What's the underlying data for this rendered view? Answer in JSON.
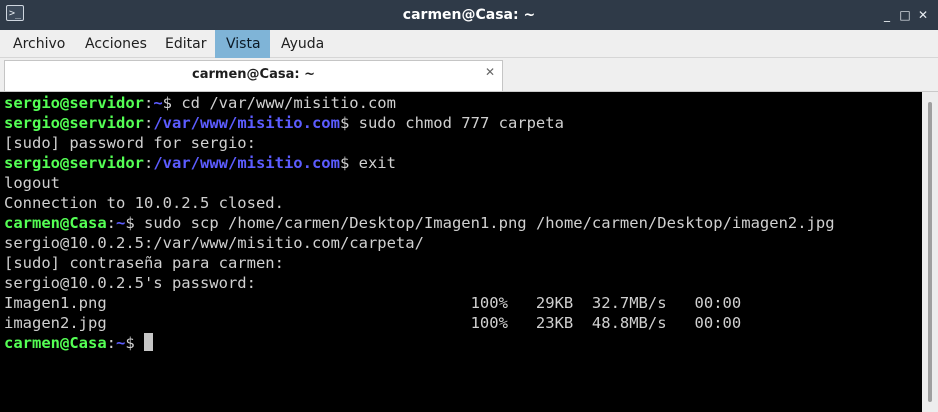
{
  "window": {
    "title": "carmen@Casa: ~",
    "icon": "terminal-icon",
    "controls": {
      "minimize": "_",
      "maximize": "□",
      "close": "✕"
    }
  },
  "menu": {
    "items": [
      {
        "label": "Archivo",
        "active": false
      },
      {
        "label": "Acciones",
        "active": false
      },
      {
        "label": "Editar",
        "active": false
      },
      {
        "label": "Vista",
        "active": true
      },
      {
        "label": "Ayuda",
        "active": false
      }
    ]
  },
  "tabs": [
    {
      "label": "carmen@Casa: ~",
      "close": "✕"
    }
  ],
  "colors": {
    "prompt_user": "#54ff54",
    "prompt_path": "#5c5cff",
    "terminal_text": "#d0d0d0",
    "terminal_bg": "#000000",
    "menu_active": "#7fb4d7"
  },
  "terminal": {
    "lines": [
      [
        {
          "t": "sergio@servidor",
          "c": "user"
        },
        {
          "t": ":",
          "c": "colon"
        },
        {
          "t": "~",
          "c": "path"
        },
        {
          "t": "$ cd /var/www/misitio.com",
          "c": "text"
        }
      ],
      [
        {
          "t": "sergio@servidor",
          "c": "user"
        },
        {
          "t": ":",
          "c": "colon"
        },
        {
          "t": "/var/www/misitio.com",
          "c": "path"
        },
        {
          "t": "$ sudo chmod 777 carpeta",
          "c": "text"
        }
      ],
      [
        {
          "t": "[sudo] password for sergio:",
          "c": "text"
        }
      ],
      [
        {
          "t": "sergio@servidor",
          "c": "user"
        },
        {
          "t": ":",
          "c": "colon"
        },
        {
          "t": "/var/www/misitio.com",
          "c": "path"
        },
        {
          "t": "$ exit",
          "c": "text"
        }
      ],
      [
        {
          "t": "logout",
          "c": "text"
        }
      ],
      [
        {
          "t": "Connection to 10.0.2.5 closed.",
          "c": "text"
        }
      ],
      [
        {
          "t": "carmen@Casa",
          "c": "user"
        },
        {
          "t": ":",
          "c": "colon"
        },
        {
          "t": "~",
          "c": "path"
        },
        {
          "t": "$ sudo scp /home/carmen/Desktop/Imagen1.png /home/carmen/Desktop/imagen2.jpg",
          "c": "text"
        }
      ],
      [
        {
          "t": "sergio@10.0.2.5:/var/www/misitio.com/carpeta/",
          "c": "text"
        }
      ],
      [
        {
          "t": "[sudo] contraseña para carmen:",
          "c": "text"
        }
      ],
      [
        {
          "t": "sergio@10.0.2.5's password:",
          "c": "text"
        }
      ],
      [
        {
          "t": "Imagen1.png                                       100%   29KB  32.7MB/s   00:00",
          "c": "text"
        }
      ],
      [
        {
          "t": "imagen2.jpg                                       100%   23KB  48.8MB/s   00:00",
          "c": "text"
        }
      ],
      [
        {
          "t": "carmen@Casa",
          "c": "user"
        },
        {
          "t": ":",
          "c": "colon"
        },
        {
          "t": "~",
          "c": "path"
        },
        {
          "t": "$ ",
          "c": "text"
        },
        {
          "t": "",
          "c": "cursor"
        }
      ]
    ]
  }
}
